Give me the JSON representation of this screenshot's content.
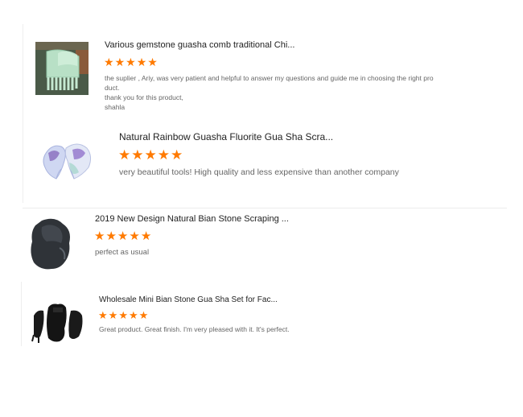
{
  "reviews": [
    {
      "title": "Various gemstone guasha comb traditional Chi...",
      "rating": 5,
      "text_lines": [
        "the suplier , Ariy, was very patient and helpful to answer my questions and guide me in choosing the right pro",
        "duct.",
        "thank you for this product,",
        "shahla"
      ],
      "image_icon": "jade-gua-sha-comb-icon"
    },
    {
      "title": "Natural Rainbow Guasha Fluorite Gua Sha Scra...",
      "rating": 5,
      "text_lines": [
        "very beautiful tools! High quality and less expensive than another company"
      ],
      "image_icon": "fluorite-gua-sha-icon"
    },
    {
      "title": "2019 New Design Natural Bian Stone Scraping ...",
      "rating": 5,
      "text_lines": [
        "perfect as usual"
      ],
      "image_icon": "bian-stone-scraper-icon"
    },
    {
      "title": "Wholesale Mini Bian Stone Gua Sha Set for Fac...",
      "rating": 5,
      "text_lines": [
        "Great product. Great finish. I'm very pleased with it. It's perfect."
      ],
      "image_icon": "bian-stone-set-icon"
    }
  ],
  "colors": {
    "star": "#ff7a00",
    "title": "#222222",
    "text": "#666666",
    "divider": "#ececec"
  }
}
